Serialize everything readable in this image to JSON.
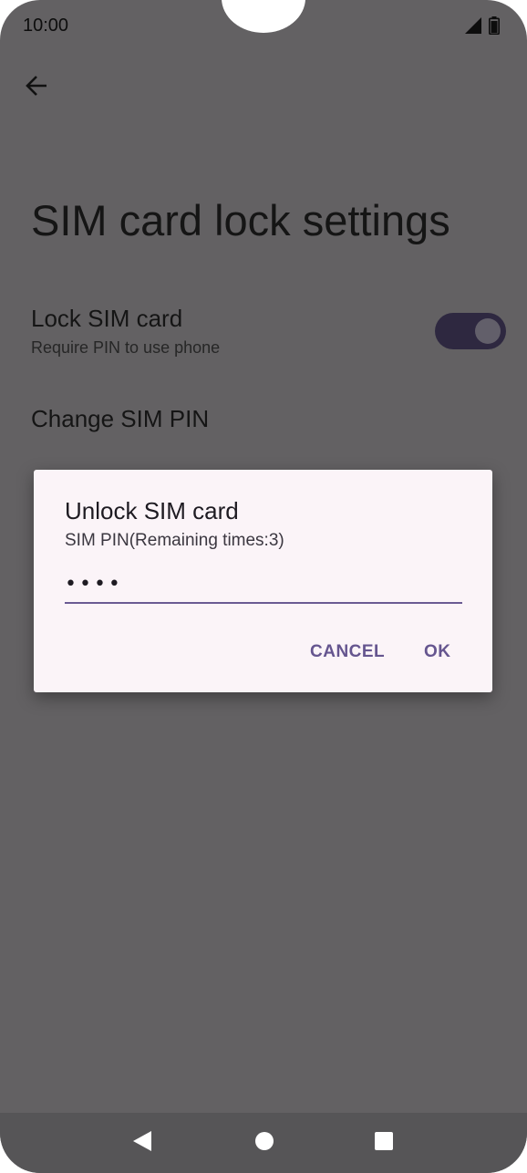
{
  "status_bar": {
    "time": "10:00",
    "icons": [
      "cellular-signal-icon",
      "battery-icon"
    ]
  },
  "toolbar": {
    "back_icon": "arrow-back-icon"
  },
  "page": {
    "title": "SIM card lock settings",
    "lock_sim": {
      "title": "Lock SIM card",
      "summary": "Require PIN to use phone",
      "toggle_on": true
    },
    "change_pin": {
      "title": "Change SIM PIN"
    }
  },
  "dialog": {
    "title": "Unlock SIM card",
    "message": "SIM PIN(Remaining times:3)",
    "pin_value": "••••",
    "cancel_label": "CANCEL",
    "ok_label": "OK"
  },
  "nav_bar": {
    "icons": [
      "back-triangle-icon",
      "home-circle-icon",
      "recents-square-icon"
    ]
  },
  "colors": {
    "scrim_background": "#636163",
    "dialog_background": "#fbf4f8",
    "accent": "#65558f",
    "toggle_track": "#2e2840"
  }
}
